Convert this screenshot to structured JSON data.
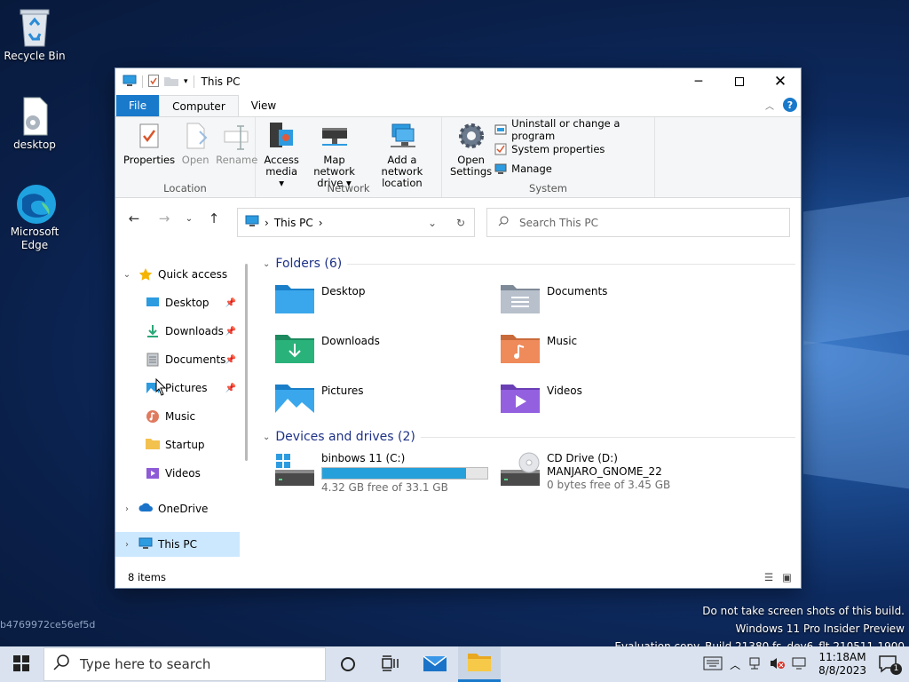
{
  "desktop": {
    "icons": [
      {
        "label": "Recycle Bin"
      },
      {
        "label": "desktop"
      },
      {
        "label": "Microsoft Edge"
      }
    ],
    "watermark": [
      "Do not take screen shots of this build.",
      "Windows 11 Pro Insider Preview",
      "Evaluation copy. Build 21380.fs_dev6_flt.210511-1900"
    ],
    "hash": "b4769972ce56ef5d"
  },
  "window": {
    "title": "This PC",
    "tabs": [
      "File",
      "Computer",
      "View"
    ],
    "ribbon": {
      "location": {
        "name": "Location",
        "buttons": [
          "Properties",
          "Open",
          "Rename"
        ]
      },
      "network": {
        "name": "Network",
        "buttons": [
          {
            "l1": "Access",
            "l2": "media"
          },
          {
            "l1": "Map network",
            "l2": "drive"
          },
          {
            "l1": "Add a network",
            "l2": "location"
          }
        ]
      },
      "system": {
        "name": "System",
        "open_l1": "Open",
        "open_l2": "Settings",
        "items": [
          "Uninstall or change a program",
          "System properties",
          "Manage"
        ]
      }
    },
    "address": {
      "path": "This PC"
    },
    "search": {
      "placeholder": "Search This PC"
    },
    "sidebar": {
      "quick_access": "Quick access",
      "items": [
        "Desktop",
        "Downloads",
        "Documents",
        "Pictures",
        "Music",
        "Startup",
        "Videos"
      ],
      "onedrive": "OneDrive",
      "thispc": "This PC"
    },
    "folders": {
      "header": "Folders (6)",
      "items": [
        "Desktop",
        "Documents",
        "Downloads",
        "Music",
        "Pictures",
        "Videos"
      ]
    },
    "drives": {
      "header": "Devices and drives (2)",
      "c": {
        "name": "binbows 11 (C:)",
        "free": "4.32 GB free of 33.1 GB",
        "used_fraction": 0.87
      },
      "d": {
        "name": "CD Drive (D:)",
        "label": "MANJARO_GNOME_22",
        "free": "0 bytes free of 3.45 GB"
      }
    },
    "status": "8 items"
  },
  "taskbar": {
    "search_placeholder": "Type here to search",
    "time": "11:18AM",
    "date": "8/8/2023",
    "notif": "1"
  },
  "colors": {
    "accent": "#1979ca",
    "bar": "#26a0da"
  }
}
